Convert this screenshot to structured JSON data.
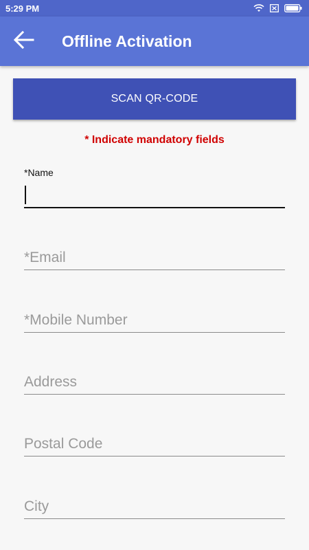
{
  "status_bar": {
    "time": "5:29 PM"
  },
  "app_bar": {
    "title": "Offline Activation",
    "back_icon": "arrow-back-icon",
    "color": "#5a74d6"
  },
  "scan_button": {
    "label": "SCAN QR-CODE",
    "color": "#3f51b5"
  },
  "mandatory_note": {
    "text": "* Indicate mandatory fields",
    "color": "#d00000"
  },
  "form": {
    "name": {
      "label": "*Name",
      "value": ""
    },
    "email": {
      "placeholder": "*Email",
      "value": ""
    },
    "mobile": {
      "placeholder": "*Mobile Number",
      "value": ""
    },
    "address": {
      "placeholder": "Address",
      "value": ""
    },
    "postal_code": {
      "placeholder": "Postal Code",
      "value": ""
    },
    "city": {
      "placeholder": "City",
      "value": ""
    }
  }
}
